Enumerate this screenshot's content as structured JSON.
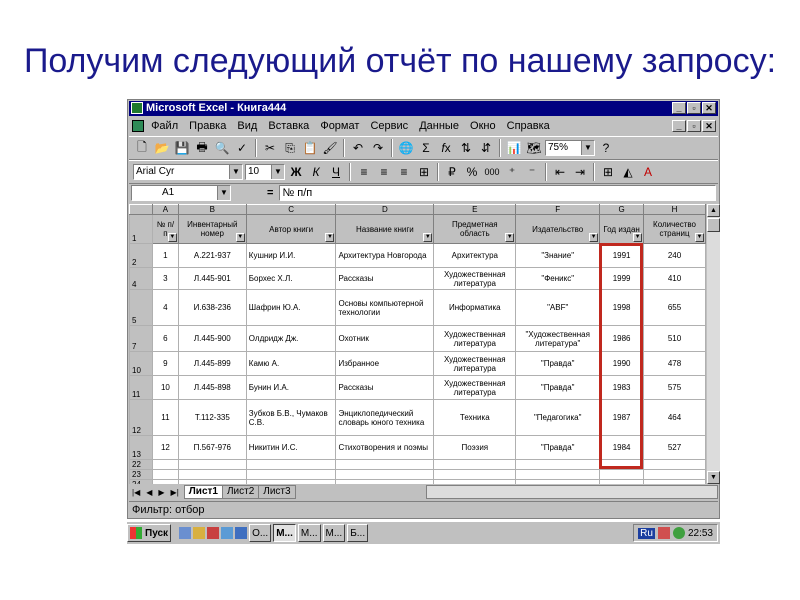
{
  "heading": "Получим следующий отчёт по нашему запросу:",
  "window": {
    "title": "Microsoft Excel - Книга444",
    "buttons": [
      "_",
      "▫",
      "✕"
    ],
    "menu": [
      "Файл",
      "Правка",
      "Вид",
      "Вставка",
      "Формат",
      "Сервис",
      "Данные",
      "Окно",
      "Справка"
    ]
  },
  "toolbar": {
    "zoom": "75%",
    "font_name": "Arial Cyr",
    "font_size": "10",
    "bold": "Ж",
    "italic": "К",
    "underline": "Ч",
    "percent": "%",
    "thousands": "000"
  },
  "formula_bar": {
    "name_box": "A1",
    "equals": "=",
    "content": "№ п/п"
  },
  "columns": [
    "A",
    "B",
    "C",
    "D",
    "E",
    "F",
    "G",
    "H"
  ],
  "headers": [
    "№ п/п",
    "Инвентарный номер",
    "Автор книги",
    "Название книги",
    "Предметная область",
    "Издательство",
    "Год издан",
    "Количество страниц"
  ],
  "rows": [
    {
      "rn": "2",
      "cells": [
        "1",
        "А.221-937",
        "Кушнир И.И.",
        "Архитектура Новгорода",
        "Архитектура",
        "\"Знание\"",
        "1991",
        "240"
      ]
    },
    {
      "rn": "4",
      "cells": [
        "3",
        "Л.445-901",
        "Борхес Х.Л.",
        "Рассказы",
        "Художественная литература",
        "\"Феникс\"",
        "1999",
        "410"
      ]
    },
    {
      "rn": "5",
      "cells": [
        "4",
        "И.638-236",
        "Шафрин Ю.А.",
        "Основы компьютерной технологии",
        "Информатика",
        "\"ABF\"",
        "1998",
        "655"
      ]
    },
    {
      "rn": "7",
      "cells": [
        "6",
        "Л.445-900",
        "Олдридж Дж.",
        "Охотник",
        "Художественная литература",
        "\"Художественная литература\"",
        "1986",
        "510"
      ]
    },
    {
      "rn": "10",
      "cells": [
        "9",
        "Л.445-899",
        "Камю А.",
        "Избранное",
        "Художественная литература",
        "\"Правда\"",
        "1990",
        "478"
      ]
    },
    {
      "rn": "11",
      "cells": [
        "10",
        "Л.445-898",
        "Бунин И.А.",
        "Рассказы",
        "Художественная литература",
        "\"Правда\"",
        "1983",
        "575"
      ]
    },
    {
      "rn": "12",
      "cells": [
        "11",
        "Т.112-335",
        "Зубков Б.В., Чумаков С.В.",
        "Энциклопедический словарь юного техника",
        "Техника",
        "\"Педагогика\"",
        "1987",
        "464"
      ]
    },
    {
      "rn": "13",
      "cells": [
        "12",
        "П.567-976",
        "Никитин И.С.",
        "Стихотворения и поэмы",
        "Поэзия",
        "\"Правда\"",
        "1984",
        "527"
      ]
    }
  ],
  "header_row_num": "1",
  "empty_rows": [
    "22",
    "23",
    "24"
  ],
  "sheet_tabs": [
    "Лист1",
    "Лист2",
    "Лист3"
  ],
  "status": "Фильтр: отбор",
  "taskbar": {
    "start": "Пуск",
    "buttons": [
      "О...",
      "М...",
      "М...",
      "М...",
      "Б..."
    ],
    "lang": "Ru",
    "clock": "22:53"
  }
}
